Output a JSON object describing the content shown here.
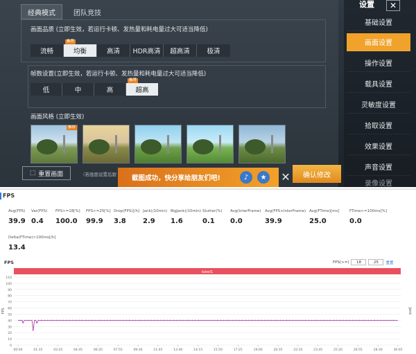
{
  "game": {
    "tabs": [
      "经典模式",
      "团队竞技"
    ],
    "quality": {
      "label": "画面品质 (立即生效，若运行卡顿、发热量和耗电量过大可适当降低)",
      "options": [
        "流畅",
        "均衡",
        "高清",
        "HDR高清",
        "超高清",
        "极清"
      ],
      "selected_index": 1,
      "tag": "推荐"
    },
    "fps": {
      "label": "帧数设置(立即生效，若运行卡顿、发热量和耗电量过大可适当降低)",
      "options": [
        "低",
        "中",
        "高",
        "超高"
      ],
      "selected_index": 3,
      "tag": "推荐"
    },
    "style": {
      "label": "画面风格 (立即生效)",
      "tag": "推荐"
    },
    "reset_label": "重置画面",
    "reset_note": "（若画面设置后跟",
    "toast": "截图成功，快分享给朋友们吧!",
    "confirm_label": "确认修改",
    "sidebar": {
      "title": "设置",
      "close": "✕",
      "items": [
        "基础设置",
        "画面设置",
        "操作设置",
        "载具设置",
        "灵敏度设置",
        "拾取设置",
        "效果设置",
        "声音设置",
        "录像设置"
      ],
      "active_index": 1
    }
  },
  "fps_panel": {
    "title": "FPS",
    "metrics_row1": [
      {
        "label": "Avg(FPS)",
        "value": "39.9"
      },
      {
        "label": "Var(FPS)",
        "value": "0.4"
      },
      {
        "label": "FPS>=18[%]",
        "value": "100.0"
      },
      {
        "label": "FPS>=25[%]",
        "value": "99.9"
      },
      {
        "label": "Drop(FPS)[/h]",
        "value": "3.8"
      },
      {
        "label": "Jank(/10min)",
        "value": "2.9"
      },
      {
        "label": "BigJank(/10min)",
        "value": "1.6"
      },
      {
        "label": "Stutter(%)",
        "value": "0.1"
      },
      {
        "label": "Avg(InterFrame)",
        "value": "0.0"
      },
      {
        "label": "Avg(FPS+InterFrame)",
        "value": "39.9"
      },
      {
        "label": "Avg(FTime)[ms]",
        "value": "25.0"
      },
      {
        "label": "FTime>=100ms[%]",
        "value": "0.0"
      }
    ],
    "metrics_row2": [
      {
        "label": "Delta(FTime)>100ms[/h]",
        "value": "13.4"
      }
    ],
    "chart_title": "FPS",
    "range_label": "FPS(>=)",
    "range_values": [
      "18",
      "25"
    ],
    "range_reset": "重置"
  },
  "chart_data": {
    "type": "line",
    "band_label": "label1",
    "band_color": "#e9505f",
    "line_color": "#b23fb0",
    "ylabel": "FPS",
    "y2label": "Jank",
    "ylim": [
      0,
      110
    ],
    "yticks": [
      0,
      10,
      20,
      30,
      40,
      50,
      60,
      70,
      80,
      90,
      100,
      110
    ],
    "xticks": [
      "00:00",
      "01:35",
      "03:10",
      "04:45",
      "06:20",
      "07:55",
      "09:30",
      "11:05",
      "12:40",
      "14:15",
      "15:50",
      "17:25",
      "19:00",
      "20:35",
      "22:10",
      "23:45",
      "25:20",
      "26:55",
      "28:30",
      "30:05"
    ],
    "baseline": 40,
    "dips": [
      {
        "t": 0.4,
        "value": 36
      },
      {
        "t": 1.2,
        "value": 24
      },
      {
        "t": 1.5,
        "value": 36
      }
    ]
  }
}
